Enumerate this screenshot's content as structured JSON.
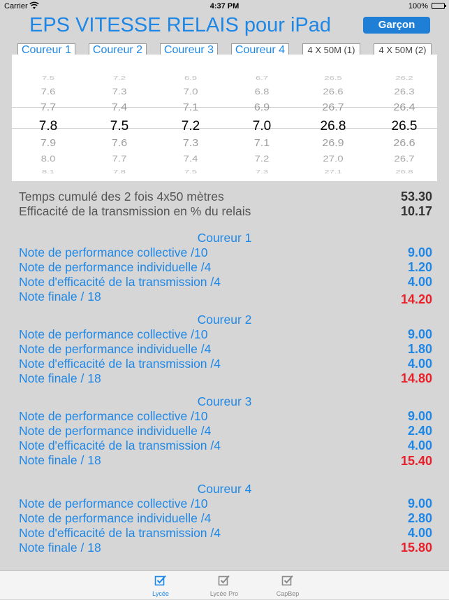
{
  "status_bar": {
    "carrier": "Carrier",
    "time": "4:37 PM",
    "battery": "100%"
  },
  "header": {
    "title": "EPS VITESSE RELAIS pour iPad",
    "gender_button": "Garçon"
  },
  "picker": {
    "columns": [
      {
        "label": "Coureur 1",
        "values": [
          "8.1",
          "8.0",
          "7.9",
          "7.8",
          "7.7",
          "7.6",
          "7.5"
        ]
      },
      {
        "label": "Coureur 2",
        "values": [
          "7.8",
          "7.7",
          "7.6",
          "7.5",
          "7.4",
          "7.3",
          "7.2"
        ]
      },
      {
        "label": "Coureur 3",
        "values": [
          "7.5",
          "7.4",
          "7.3",
          "7.2",
          "7.1",
          "7.0",
          "6.9"
        ]
      },
      {
        "label": "Coureur 4",
        "values": [
          "7.3",
          "7.2",
          "7.1",
          "7.0",
          "6.9",
          "6.8",
          "6.7"
        ]
      },
      {
        "label": "4 X 50M (1)",
        "values": [
          "27.1",
          "27.0",
          "26.9",
          "26.8",
          "26.7",
          "26.6",
          "26.5"
        ]
      },
      {
        "label": "4 X 50M (2)",
        "values": [
          "26.8",
          "26.7",
          "26.6",
          "26.5",
          "26.4",
          "26.3",
          "26.2"
        ]
      }
    ]
  },
  "summary": [
    {
      "label": "Temps cumulé des 2 fois 4x50 mètres",
      "value": "53.30"
    },
    {
      "label": "Efficacité de la transmission en % du relais",
      "value": "10.17"
    }
  ],
  "runners": [
    {
      "title": "Coureur 1",
      "notes": [
        {
          "label": "Note de performance collective /10",
          "value": "9.00"
        },
        {
          "label": "Note de performance individuelle /4",
          "value": "1.20"
        },
        {
          "label": "Note d'efficacité de la transmission /4",
          "value": "4.00"
        },
        {
          "label": "Note finale / 18",
          "value": "14.20"
        }
      ]
    },
    {
      "title": "Coureur 2",
      "notes": [
        {
          "label": "Note de performance collective /10",
          "value": "9.00"
        },
        {
          "label": "Note de performance individuelle /4",
          "value": "1.80"
        },
        {
          "label": "Note d'efficacité de la transmission /4",
          "value": "4.00"
        },
        {
          "label": "Note finale / 18",
          "value": "14.80"
        }
      ]
    },
    {
      "title": "Coureur 3",
      "notes": [
        {
          "label": "Note de performance collective /10",
          "value": "9.00"
        },
        {
          "label": "Note de performance individuelle /4",
          "value": "2.40"
        },
        {
          "label": "Note d'efficacité de la transmission /4",
          "value": "4.00"
        },
        {
          "label": "Note finale / 18",
          "value": "15.40"
        }
      ]
    },
    {
      "title": "Coureur 4",
      "notes": [
        {
          "label": "Note de performance collective /10",
          "value": "9.00"
        },
        {
          "label": "Note de performance individuelle /4",
          "value": "2.80"
        },
        {
          "label": "Note d'efficacité de la transmission /4",
          "value": "4.00"
        },
        {
          "label": "Note finale / 18",
          "value": "15.80"
        }
      ]
    }
  ],
  "tab_bar": {
    "items": [
      {
        "label": "Lycée",
        "icon": "checkbox-icon",
        "selected": true
      },
      {
        "label": "Lycée Pro",
        "icon": "checkbox-icon",
        "selected": false
      },
      {
        "label": "CapBep",
        "icon": "checkbox-icon",
        "selected": false
      }
    ]
  },
  "colors": {
    "accent": "#1e87e6",
    "final_note": "#e8202a",
    "button": "#1f7fd6",
    "background": "#d6d6d6"
  }
}
